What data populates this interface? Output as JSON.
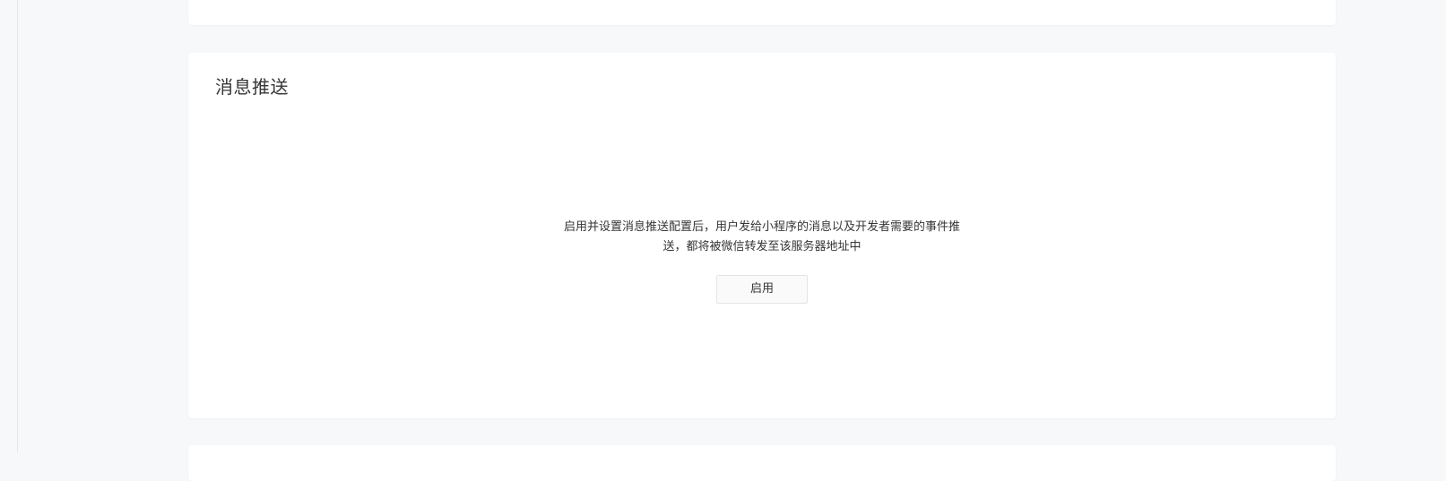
{
  "message_push": {
    "title": "消息推送",
    "description_line1": "启用并设置消息推送配置后，用户发给小程序的消息以及开发者需要的事件推",
    "description_line2": "送，都将被微信转发至该服务器地址中",
    "enable_button_label": "启用"
  }
}
